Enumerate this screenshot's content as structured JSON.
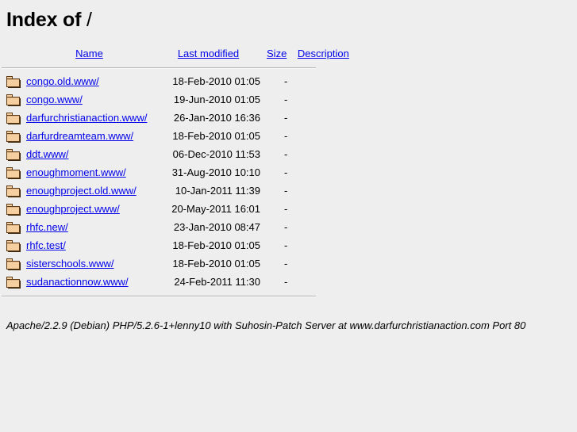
{
  "page": {
    "title_prefix": "Index of ",
    "title_path": "/"
  },
  "table": {
    "headers": {
      "name": "Name",
      "last_modified": "Last modified",
      "size": "Size",
      "description": "Description"
    },
    "icon_name": "folder-icon",
    "entries": [
      {
        "name": "congo.old.www/",
        "last_modified": "18-Feb-2010 01:05",
        "size": "-",
        "description": ""
      },
      {
        "name": "congo.www/",
        "last_modified": "19-Jun-2010 01:05",
        "size": "-",
        "description": ""
      },
      {
        "name": "darfurchristianaction.www/",
        "last_modified": "26-Jan-2010 16:36",
        "size": "-",
        "description": ""
      },
      {
        "name": "darfurdreamteam.www/",
        "last_modified": "18-Feb-2010 01:05",
        "size": "-",
        "description": ""
      },
      {
        "name": "ddt.www/",
        "last_modified": "06-Dec-2010 11:53",
        "size": "-",
        "description": ""
      },
      {
        "name": "enoughmoment.www/",
        "last_modified": "31-Aug-2010 10:10",
        "size": "-",
        "description": ""
      },
      {
        "name": "enoughproject.old.www/",
        "last_modified": "10-Jan-2011 11:39",
        "size": "-",
        "description": ""
      },
      {
        "name": "enoughproject.www/",
        "last_modified": "20-May-2011 16:01",
        "size": "-",
        "description": ""
      },
      {
        "name": "rhfc.new/",
        "last_modified": "23-Jan-2010 08:47",
        "size": "-",
        "description": ""
      },
      {
        "name": "rhfc.test/",
        "last_modified": "18-Feb-2010 01:05",
        "size": "-",
        "description": ""
      },
      {
        "name": "sisterschools.www/",
        "last_modified": "18-Feb-2010 01:05",
        "size": "-",
        "description": ""
      },
      {
        "name": "sudanactionnow.www/",
        "last_modified": "24-Feb-2011 11:30",
        "size": "-",
        "description": ""
      }
    ]
  },
  "footer": {
    "signature": "Apache/2.2.9 (Debian) PHP/5.2.6-1+lenny10 with Suhosin-Patch Server at www.darfurchristianaction.com Port 80"
  },
  "colors": {
    "background": "#eeeeee",
    "link": "#0000ee",
    "text": "#000000",
    "rule": "#b0b0b0",
    "folder_fill": "#f5cfa0",
    "folder_outline": "#5c3a16"
  }
}
